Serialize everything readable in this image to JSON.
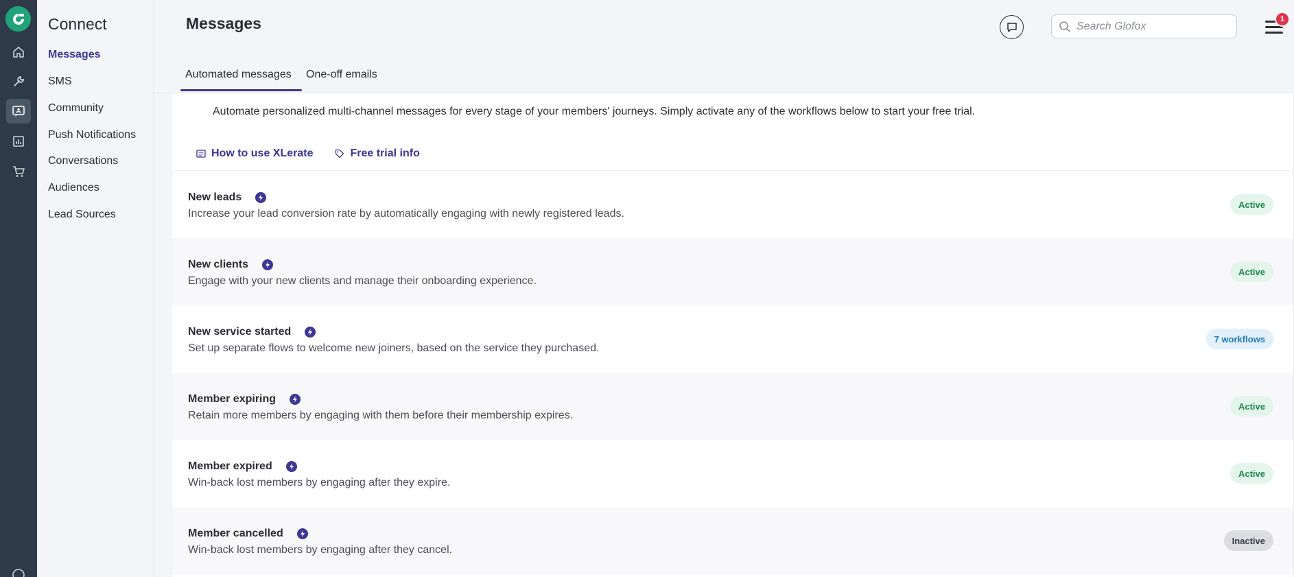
{
  "app": {
    "section_title": "Connect"
  },
  "sidebar": {
    "items": [
      {
        "label": "Messages",
        "active": true
      },
      {
        "label": "SMS"
      },
      {
        "label": "Community"
      },
      {
        "label": "Push Notifications"
      },
      {
        "label": "Conversations"
      },
      {
        "label": "Audiences"
      },
      {
        "label": "Lead Sources"
      }
    ]
  },
  "rail": {
    "icons": [
      "home-icon",
      "tools-icon",
      "connect-icon",
      "reports-icon",
      "store-icon",
      "help-icon"
    ]
  },
  "header": {
    "title": "Messages",
    "search_placeholder": "Search Glofox",
    "notification_count": "1"
  },
  "tabs": [
    {
      "label": "Automated messages",
      "active": true
    },
    {
      "label": "One-off emails"
    }
  ],
  "intro": {
    "text": "Automate personalized multi-channel messages for every stage of your members' journeys. Simply activate any of the workflows below to start your free trial.",
    "links": [
      {
        "label": "How to use XLerate",
        "icon": "book-icon"
      },
      {
        "label": "Free trial info",
        "icon": "tag-icon"
      }
    ]
  },
  "workflows": [
    {
      "title": "New leads",
      "description": "Increase your lead conversion rate by automatically engaging with newly registered leads.",
      "status": "Active"
    },
    {
      "title": "New clients",
      "description": "Engage with your new clients and manage their onboarding experience.",
      "status": "Active"
    },
    {
      "title": "New service started",
      "description": "Set up separate flows to welcome new joiners, based on the service they purchased.",
      "status": "7 workflows"
    },
    {
      "title": "Member expiring",
      "description": "Retain more members by engaging with them before their membership expires.",
      "status": "Active"
    },
    {
      "title": "Member expired",
      "description": "Win-back lost members by engaging after they expire.",
      "status": "Active"
    },
    {
      "title": "Member cancelled",
      "description": "Win-back lost members by engaging after they cancel.",
      "status": "Inactive"
    }
  ],
  "colors": {
    "brand": "#21a37a",
    "accent": "#3d3695",
    "rail": "#2e3a47",
    "active_status": "#1e8a4c",
    "info_status": "#1e78b8",
    "badge": "#e0344a"
  }
}
